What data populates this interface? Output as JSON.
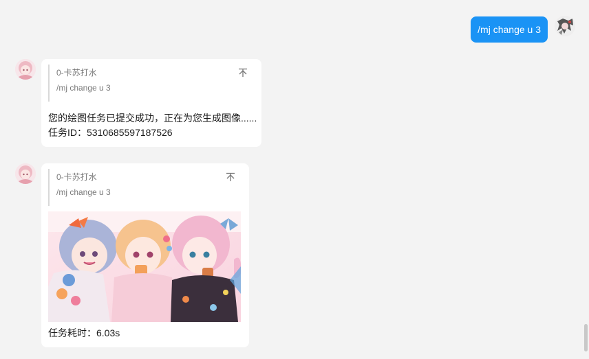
{
  "user_message": {
    "text": "/mj change u 3"
  },
  "bot_messages": [
    {
      "quote_name": "0-卡苏打水",
      "quote_command": "/mj change u 3",
      "lines": [
        "您的绘图任务已提交成功，正在为您生成图像......",
        "任务ID：5310685597187526"
      ]
    },
    {
      "quote_name": "0-卡苏打水",
      "quote_command": "/mj change u 3",
      "image_alt": "anime-girls-artwork",
      "footer": "任务耗时：6.03s"
    }
  ],
  "icons": {
    "pin": "pin-top-icon"
  },
  "colors": {
    "background": "#f3f3f3",
    "user_bubble": "#1a93f5",
    "card": "#ffffff",
    "quote_bar": "#d9d9d9",
    "muted_text": "#7a7a7a"
  }
}
